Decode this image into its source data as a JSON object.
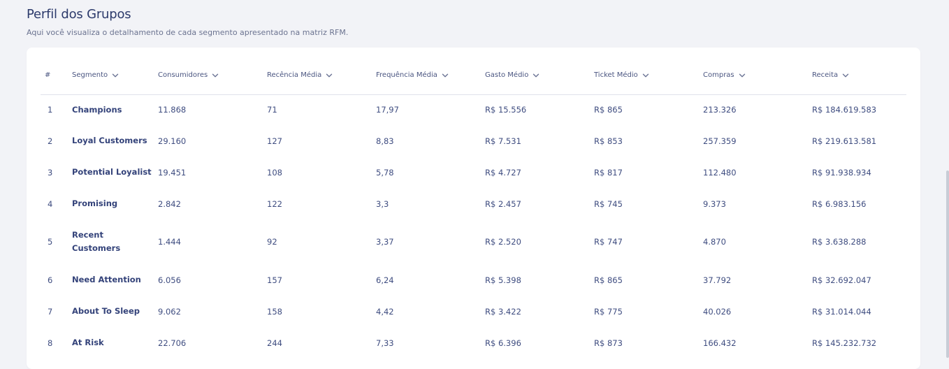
{
  "header": {
    "title": "Perfil dos Grupos",
    "subtitle": "Aqui você visualiza o detalhamento de cada segmento apresentado na matriz RFM."
  },
  "table": {
    "columns": [
      "#",
      "Segmento",
      "Consumidores",
      "Recência Média",
      "Frequência Média",
      "Gasto Médio",
      "Ticket Médio",
      "Compras",
      "Receita"
    ],
    "rows": [
      [
        "1",
        "Champions",
        "11.868",
        "71",
        "17,97",
        "R$ 15.556",
        "R$ 865",
        "213.326",
        "R$ 184.619.583"
      ],
      [
        "2",
        "Loyal Customers",
        "29.160",
        "127",
        "8,83",
        "R$ 7.531",
        "R$ 853",
        "257.359",
        "R$ 219.613.581"
      ],
      [
        "3",
        "Potential Loyalist",
        "19.451",
        "108",
        "5,78",
        "R$ 4.727",
        "R$ 817",
        "112.480",
        "R$ 91.938.934"
      ],
      [
        "4",
        "Promising",
        "2.842",
        "122",
        "3,3",
        "R$ 2.457",
        "R$ 745",
        "9.373",
        "R$ 6.983.156"
      ],
      [
        "5",
        "Recent Customers",
        "1.444",
        "92",
        "3,37",
        "R$ 2.520",
        "R$ 747",
        "4.870",
        "R$ 3.638.288"
      ],
      [
        "6",
        "Need Attention",
        "6.056",
        "157",
        "6,24",
        "R$ 5.398",
        "R$ 865",
        "37.792",
        "R$ 32.692.047"
      ],
      [
        "7",
        "About To Sleep",
        "9.062",
        "158",
        "4,42",
        "R$ 3.422",
        "R$ 775",
        "40.026",
        "R$ 31.014.044"
      ],
      [
        "8",
        "At Risk",
        "22.706",
        "244",
        "7,33",
        "R$ 6.396",
        "R$ 873",
        "166.432",
        "R$ 145.232.732"
      ]
    ]
  },
  "icons": {
    "sort": "chevron-down-icon"
  },
  "colors": {
    "background": "#f2f3f7",
    "card": "#ffffff",
    "text": "#3b4a7a"
  }
}
